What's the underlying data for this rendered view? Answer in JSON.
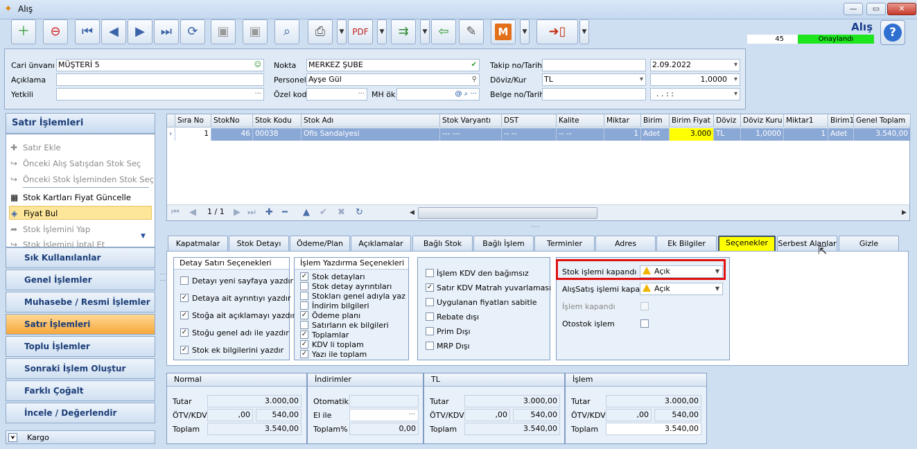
{
  "window": {
    "title": "Alış",
    "min": "—",
    "max": "▭",
    "close": "✕"
  },
  "header": {
    "doc_title": "Alış",
    "count": "45",
    "status": "Onaylandı",
    "help": "?"
  },
  "toolbar": {
    "icons": [
      "new-doc",
      "delete-doc",
      "first",
      "prev",
      "next",
      "last",
      "refresh",
      "save",
      "save-close",
      "preview",
      "print",
      "pdf-export",
      "export",
      "import",
      "tools",
      "m-module",
      "exit"
    ]
  },
  "form": {
    "cari_label": "Cari ünvanı",
    "cari_value": "MÜŞTERİ 5",
    "aciklama_label": "Açıklama",
    "aciklama_value": "",
    "yetkili_label": "Yetkili",
    "yetkili_value": "",
    "nokta_label": "Nokta",
    "nokta_value": "MERKEZ ŞUBE",
    "personel_label": "Personel",
    "personel_value": "Ayşe Gül",
    "ozelkod_label": "Özel kod",
    "ozelkod_value": "",
    "mhok_label": "MH ök",
    "mhok_value": "",
    "takip_label": "Takip no/Tarih",
    "takip_value": "",
    "tarih_value": "2.09.2022",
    "doviz_label": "Döviz/Kur",
    "doviz_value": "TL",
    "kur_value": "1,0000",
    "belge_label": "Belge no/Tarih",
    "belge_value": "",
    "belge_tarih_value": ". .    : :"
  },
  "left_panel": {
    "title": "Satır İşlemleri",
    "actions": [
      {
        "label": "Satır Ekle",
        "icon": "+"
      },
      {
        "label": "Önceki Alış Satışdan Stok Seç",
        "icon": "↪"
      },
      {
        "label": "Önceki Stok İşleminden Stok Seç",
        "icon": "↪"
      },
      {
        "label": "Stok Kartları Fiyat Güncelle",
        "icon": "▦"
      },
      {
        "label": "Fiyat Bul",
        "icon": "◈"
      },
      {
        "label": "Stok İşlemini Yap",
        "icon": "➦"
      },
      {
        "label": "Stok İşlemini İptal Et",
        "icon": "↪"
      }
    ],
    "groups": [
      "Sık Kullanılanlar",
      "Genel İşlemler",
      "Muhasebe / Resmi İşlemler",
      "Satır İşlemleri",
      "Toplu İşlemler",
      "Sonraki İşlem Oluştur",
      "Farklı Çoğalt",
      "İncele / Değerlendir"
    ],
    "footer": "Kargo"
  },
  "grid": {
    "columns": [
      "Sıra No",
      "StokNo",
      "Stok Kodu",
      "Stok Adı",
      "Stok Varyantı",
      "DST",
      "Kalite",
      "Miktar",
      "Birim",
      "Birim Fiyat",
      "Döviz",
      "Döviz Kuru",
      "Miktar1",
      "Birim1",
      "Genel Toplam"
    ],
    "rows": [
      [
        "1",
        "46",
        "00038",
        "Ofis Sandalyesi",
        "--- ---",
        "-- --",
        "-- --",
        "1",
        "Adet",
        "3.000",
        "TL",
        "1,0000",
        "1",
        "Adet",
        "3.540,00"
      ]
    ],
    "pager": "1 / 1"
  },
  "tabs": [
    "Kapatmalar",
    "Stok Detayı",
    "Ödeme/Plan",
    "Açıklamalar",
    "Bağlı Stok",
    "Bağlı İşlem",
    "Terminler",
    "Adres",
    "Ek Bilgiler",
    "Seçenekler",
    "Serbest Alanlar",
    "Gizle"
  ],
  "options": {
    "detay_title": "Detay Satırı Seçenekleri",
    "detay": [
      {
        "label": "Detayı yeni sayfaya yazdır",
        "checked": false
      },
      {
        "label": "Detaya ait ayrıntıyı yazdır",
        "checked": true
      },
      {
        "label": "Stoğa ait açıklamayı yazdır",
        "checked": true
      },
      {
        "label": "Stoğu genel adı ile yazdır",
        "checked": true
      },
      {
        "label": "Stok ek bilgilerini yazdır",
        "checked": true
      }
    ],
    "yazdirma_title": "İşlem Yazdırma Seçenekleri",
    "yazdirma": [
      {
        "label": "Stok detayları",
        "checked": true
      },
      {
        "label": "Stok detay ayrıntıları",
        "checked": false
      },
      {
        "label": "Stokları genel adıyla yaz",
        "checked": false
      },
      {
        "label": "İndirim bilgileri",
        "checked": false
      },
      {
        "label": "Ödeme planı",
        "checked": true
      },
      {
        "label": "Satırların ek bilgileri",
        "checked": false
      },
      {
        "label": "Toplamlar",
        "checked": true
      },
      {
        "label": "KDV li toplam",
        "checked": true
      },
      {
        "label": "Yazı ile toplam",
        "checked": true
      }
    ],
    "kdv": [
      {
        "label": "İşlem KDV den bağımsız",
        "checked": false
      },
      {
        "label": "Satır KDV Matrah yuvarlaması",
        "checked": true
      },
      {
        "label": "Uygulanan fiyatları sabitle",
        "checked": false
      },
      {
        "label": "Rebate dışı",
        "checked": false
      },
      {
        "label": "Prim Dışı",
        "checked": false
      },
      {
        "label": "MRP Dışı",
        "checked": false
      }
    ],
    "stok_kapandi_label": "Stok işlemi kapandı",
    "stok_kapandi_value": "Açık",
    "alissatis_kapandi_label": "AlışSatış işlemi kapandı",
    "alissatis_kapandi_value": "Açık",
    "islem_kapandi_label": "İşlem kapandı",
    "otostok_label": "Otostok işlem"
  },
  "totals": {
    "normal": {
      "title": "Normal",
      "tutar_label": "Tutar",
      "tutar": "3.000,00",
      "otv_label": "ÖTV/KDV",
      "otv": ",00",
      "kdv": "540,00",
      "toplam_label": "Toplam",
      "toplam": "3.540,00"
    },
    "indirim": {
      "title": "İndirimler",
      "otomatik_label": "Otomatik",
      "otomatik": "",
      "elile_label": "El ile",
      "elile": "",
      "toplam_label": "Toplam%",
      "toplam": "0,00"
    },
    "tl": {
      "title": "TL",
      "tutar_label": "Tutar",
      "tutar": "3.000,00",
      "otv_label": "ÖTV/KDV",
      "otv": ",00",
      "kdv": "540,00",
      "toplam_label": "Toplam",
      "toplam": "3.540,00"
    },
    "islem": {
      "title": "İşlem",
      "tutar_label": "Tutar",
      "tutar": "3.000,00",
      "otv_label": "ÖTV/KDV",
      "otv": ",00",
      "kdv": "540,00",
      "toplam_label": "Toplam",
      "toplam": "3.540,00"
    }
  }
}
